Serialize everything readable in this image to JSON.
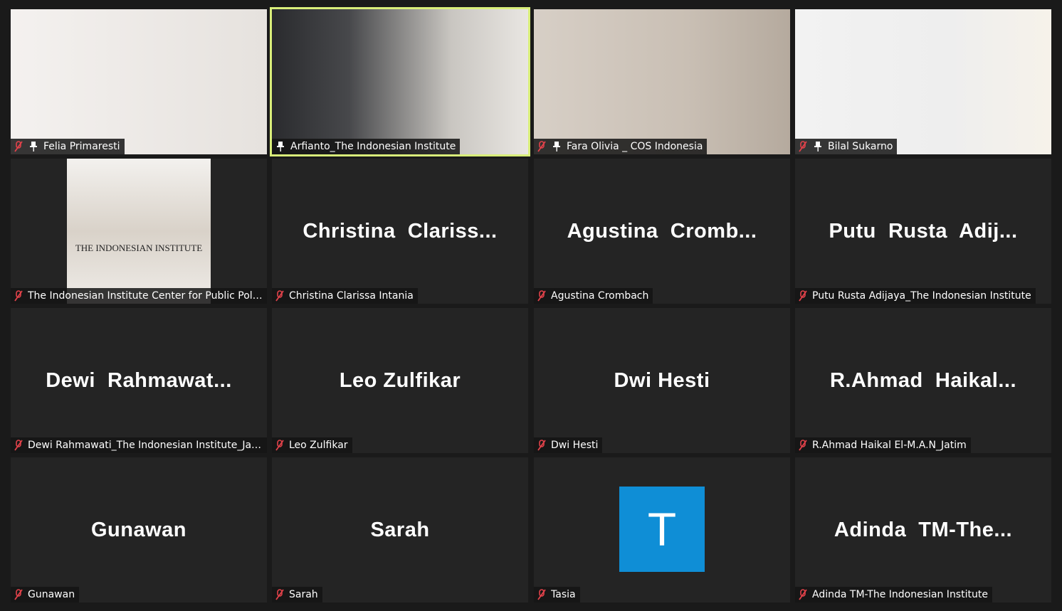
{
  "participants": [
    {
      "name": "Felia Primaresti",
      "pinned": true,
      "muted": true
    },
    {
      "name": "Arfianto_The Indonesian Institute",
      "pinned": true,
      "muted": false,
      "speaking": true
    },
    {
      "name": "Fara Olivia _ COS Indonesia",
      "pinned": true,
      "muted": true
    },
    {
      "name": "Bilal Sukarno",
      "pinned": true,
      "muted": true
    },
    {
      "name": "The Indonesian Institute Center for Public Poli...",
      "muted": true
    },
    {
      "name": "Christina Clarissa Intania",
      "display": "Christina  Clariss...",
      "muted": true
    },
    {
      "name": "Agustina Crombach",
      "display": "Agustina  Cromb...",
      "muted": true
    },
    {
      "name": "Putu Rusta Adijaya_The Indonesian Institute",
      "display": "Putu  Rusta  Adij...",
      "muted": true
    },
    {
      "name": "Dewi Rahmawati_The Indonesian Institute_Jak...",
      "display": "Dewi  Rahmawat...",
      "muted": true
    },
    {
      "name": "Leo Zulfikar",
      "display": "Leo Zulfikar",
      "muted": true
    },
    {
      "name": "Dwi Hesti",
      "display": "Dwi Hesti",
      "muted": true
    },
    {
      "name": "R.Ahmad Haikal El-M.A.N_Jatim",
      "display": "R.Ahmad  Haikal...",
      "muted": true
    },
    {
      "name": "Gunawan",
      "display": "Gunawan",
      "muted": true
    },
    {
      "name": "Sarah",
      "display": "Sarah",
      "muted": true
    },
    {
      "name": "Tasia",
      "avatar_letter": "T",
      "muted": true
    },
    {
      "name": "Adinda TM-The Indonesian Institute",
      "display": "Adinda  TM-The...",
      "muted": true
    }
  ],
  "logo_text": "THE INDONESIAN INSTITUTE",
  "colors": {
    "active_border": "#d9ee7a",
    "muted_icon": "#e2424a",
    "avatar_bg": "#0f8ed6",
    "tile_bg": "#242424"
  }
}
